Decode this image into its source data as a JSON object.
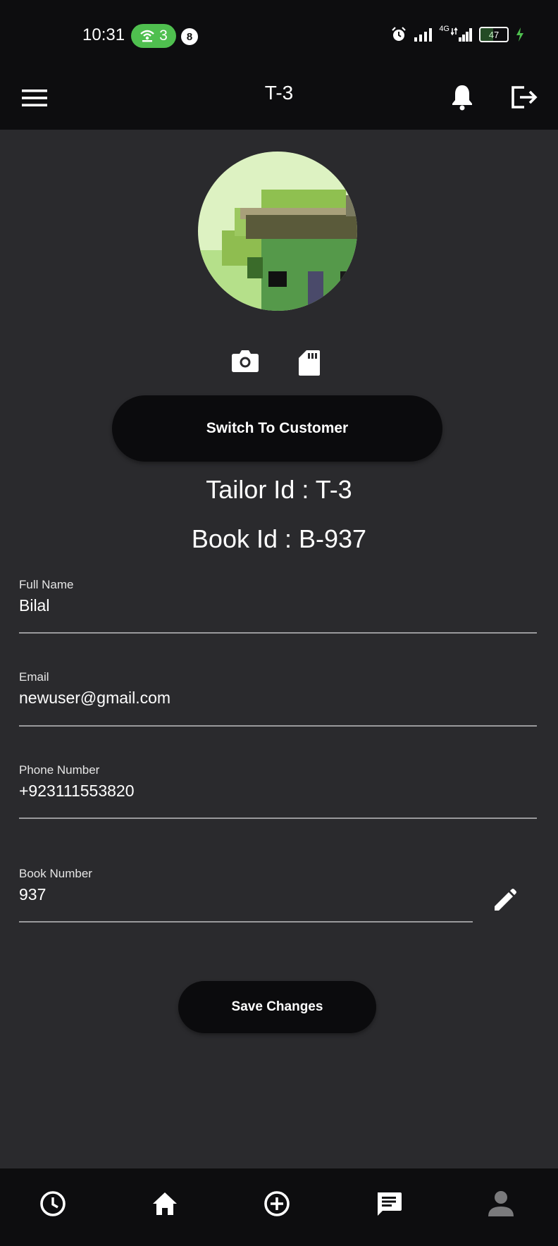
{
  "status_bar": {
    "time": "10:31",
    "hotspot_count": "3",
    "notification_count": "8",
    "network": "4G",
    "battery": "47"
  },
  "app_bar": {
    "title": "T-3",
    "menu_icon": "hamburger-menu-icon",
    "notification_icon": "bell-icon",
    "logout_icon": "logout-icon"
  },
  "profile": {
    "camera_icon": "camera-icon",
    "gallery_icon": "sd-card-icon",
    "switch_button": "Switch To Customer",
    "tailor_id": "Tailor Id : T-3",
    "book_id": "Book Id : B-937"
  },
  "form": {
    "fields": [
      {
        "label": "Full Name",
        "value": "Bilal"
      },
      {
        "label": "Email",
        "value": "newuser@gmail.com"
      },
      {
        "label": "Phone Number",
        "value": "+923111553820"
      },
      {
        "label": "Book Number",
        "value": "937"
      }
    ],
    "edit_icon": "pencil-icon",
    "save_button": "Save Changes"
  },
  "bottom_nav": {
    "items": [
      {
        "icon": "history-icon",
        "active": false
      },
      {
        "icon": "home-icon",
        "active": false
      },
      {
        "icon": "add-circle-icon",
        "active": false
      },
      {
        "icon": "chat-icon",
        "active": false
      },
      {
        "icon": "person-icon",
        "active": true
      }
    ]
  },
  "colors": {
    "background": "#2a2a2d",
    "bar": "#0d0d0f",
    "button": "#0b0b0d",
    "hotspot": "#4fbf4f",
    "underline": "#9a9a9c",
    "inactive_nav": "#7a7a7c"
  }
}
